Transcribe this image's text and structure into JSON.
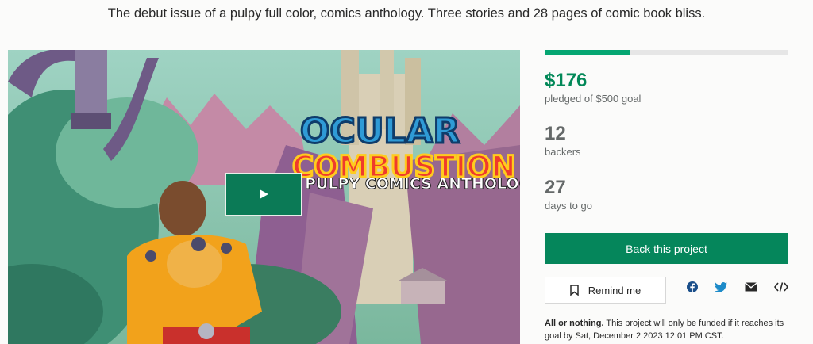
{
  "blurb": "The debut issue of a pulpy full color, comics anthology. Three stories and 28 pages of comic book bliss.",
  "hero": {
    "title_line1": "OCULAR",
    "title_line2": "COMBUSTION",
    "subtitle": "PULPY COMICS ANTHOLOGY",
    "play_icon": "play-icon"
  },
  "campaign": {
    "progress_fraction": 0.352,
    "pledged": "$176",
    "pledged_label": "pledged of $500 goal",
    "backers": "12",
    "backers_label": "backers",
    "days": "27",
    "days_label": "days to go"
  },
  "actions": {
    "back_label": "Back this project",
    "remind_label": "Remind me",
    "share_icons": [
      "facebook-icon",
      "twitter-icon",
      "email-icon",
      "embed-icon"
    ]
  },
  "fine_print": {
    "link": "All or nothing.",
    "text": " This project will only be funded if it reaches its goal by Sat, December 2 2023 12:01 PM CST."
  },
  "colors": {
    "accent": "#05865b",
    "pledged": "#028858",
    "progress": "#05a672"
  }
}
